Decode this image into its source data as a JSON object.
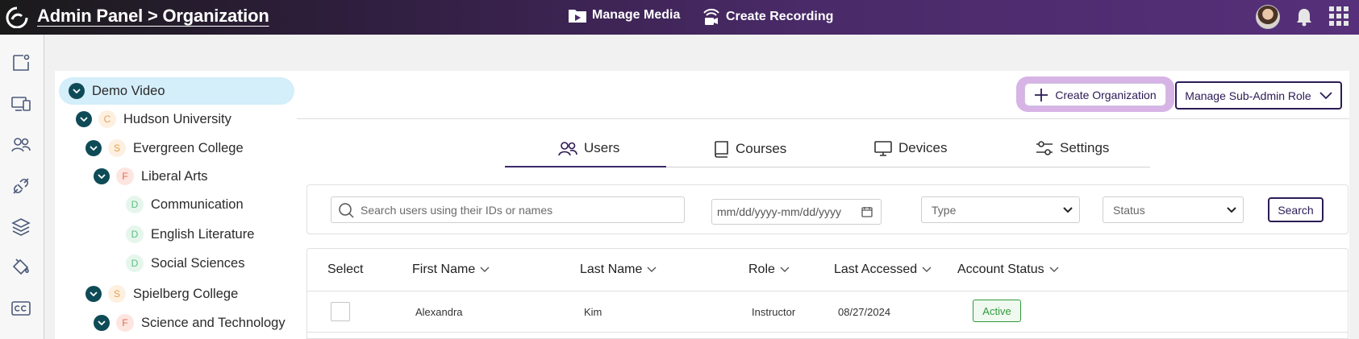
{
  "header": {
    "title": "Admin Panel > Organization",
    "actions": [
      {
        "label": "Manage Media",
        "icon": "media-folder-icon"
      },
      {
        "label": "Create Recording",
        "icon": "recording-icon"
      }
    ]
  },
  "sidebar": {
    "icons": [
      "page-icon",
      "devices-icon",
      "users-icon",
      "plug-icon",
      "layers-icon",
      "bucket-icon",
      "captions-icon"
    ]
  },
  "tree": {
    "nodes": [
      {
        "label": "Demo Video",
        "badge": "",
        "expanded": true,
        "selected": true
      },
      {
        "label": "Hudson University",
        "badge": "C",
        "expanded": true
      },
      {
        "label": "Evergreen College",
        "badge": "S",
        "expanded": true
      },
      {
        "label": "Liberal Arts",
        "badge": "F",
        "expanded": true
      },
      {
        "label": "Communication",
        "badge": "D"
      },
      {
        "label": "English Literature",
        "badge": "D"
      },
      {
        "label": "Social Sciences",
        "badge": "D"
      },
      {
        "label": "Spielberg College",
        "badge": "S",
        "expanded": true
      },
      {
        "label": "Science and Technology",
        "badge": "F",
        "expanded": true
      }
    ]
  },
  "toolbar": {
    "create_org_label": "Create Organization",
    "subadmin_label": "Manage Sub-Admin Role"
  },
  "tabs": [
    {
      "label": "Users",
      "active": true
    },
    {
      "label": "Courses"
    },
    {
      "label": "Devices"
    },
    {
      "label": "Settings"
    }
  ],
  "filters": {
    "search_placeholder": "Search users using their IDs or names",
    "date_placeholder": "mm/dd/yyyy-mm/dd/yyyy",
    "type_label": "Type",
    "status_label": "Status",
    "search_button": "Search"
  },
  "table": {
    "columns": [
      "Select",
      "First Name",
      "Last Name",
      "Role",
      "Last Accessed",
      "Account Status"
    ],
    "rows": [
      {
        "first_name": "Alexandra",
        "last_name": "Kim",
        "role": "Instructor",
        "last_accessed": "08/27/2024",
        "status": "Active"
      }
    ]
  },
  "colors": {
    "accent": "#2b1b55",
    "tree_chevron": "#0e4b57",
    "selected_row": "#d4eefa",
    "active_badge": "#2f9a3c",
    "highlight_ring": "#d7b3e6"
  }
}
